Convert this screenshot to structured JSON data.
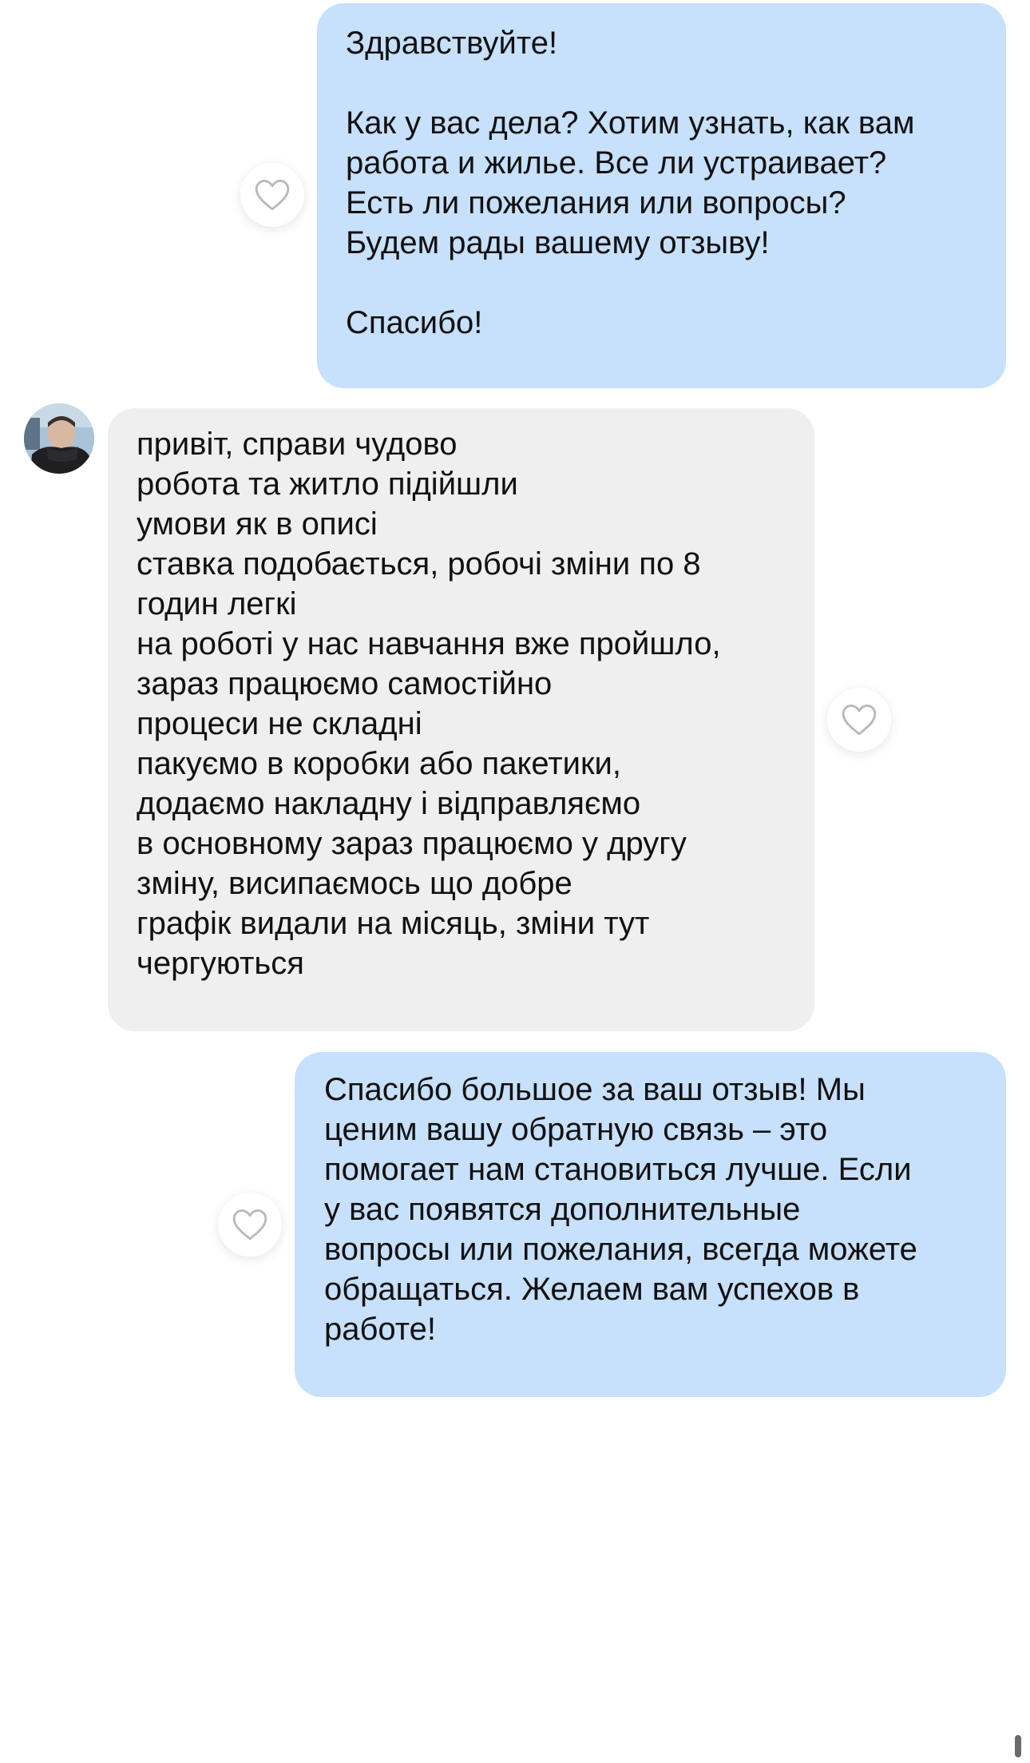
{
  "conversation": {
    "messages": [
      {
        "direction": "outgoing",
        "text": "Здравствуйте!\n\nКак у вас дела? Хотим узнать, как вам\nработа и жилье. Все ли устраивает?\nЕсть ли пожелания или вопросы?\nБудем рады вашему отзыву!\n\nСпасибо!"
      },
      {
        "direction": "incoming",
        "text": "привіт, справи чудово\nробота та житло підійшли\nумови як в описі\nставка подобається, робочі зміни по 8\nгодин легкі\nна роботі у нас навчання вже пройшло,\nзараз працюємо самостійно\nпроцеси не складні\nпакуємо в коробки або пакетики,\nдодаємо накладну і відправляємо\nв основному зараз працюємо у другу\nзміну, висипаємось що добре\nграфік видали на місяць, зміни тут\nчергуються"
      },
      {
        "direction": "outgoing",
        "text": "Спасибо большое за ваш отзыв! Мы\nценим вашу обратную связь – это\nпомогает нам становиться лучше. Если\nу вас появятся дополнительные\nвопросы или пожелания, всегда можете\nобращаться. Желаем вам успехов в\nработе!"
      }
    ]
  },
  "icons": {
    "like": "heart-outline-icon",
    "avatar": "user-avatar"
  },
  "colors": {
    "outgoing_bubble": "#c7e0fc",
    "incoming_bubble": "#efefef",
    "background": "#ffffff",
    "text": "#111111",
    "like_stroke": "#b9b9b9"
  }
}
